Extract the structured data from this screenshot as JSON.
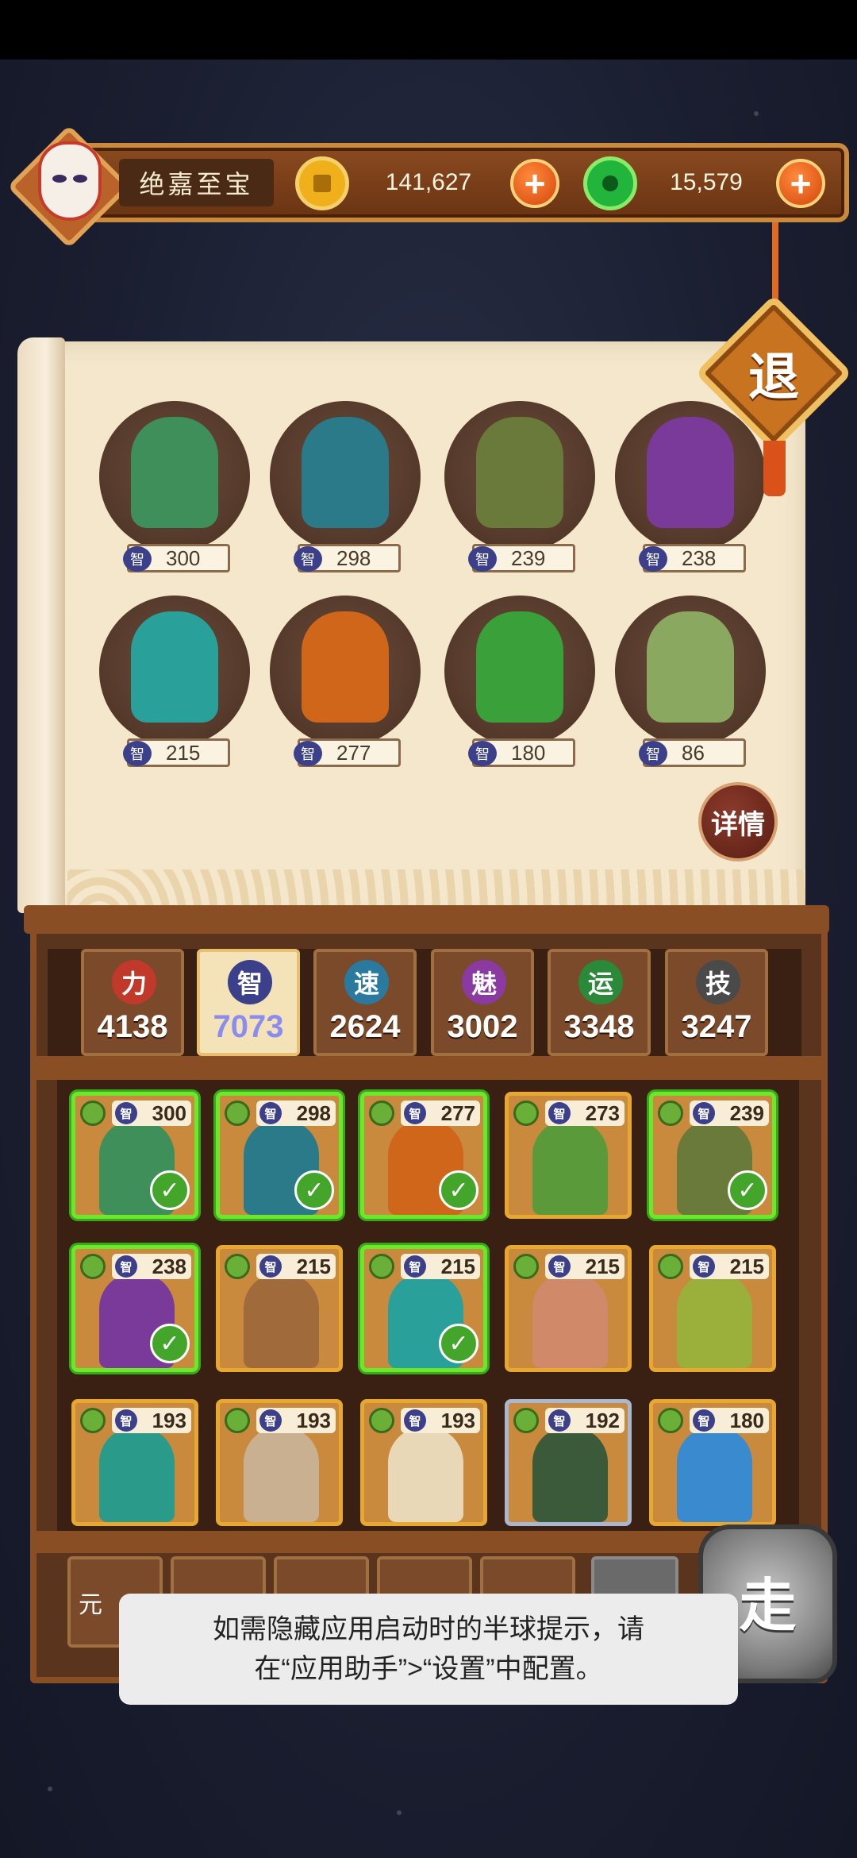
{
  "player": {
    "name": "绝嘉至宝",
    "gold": "141,627",
    "jade": "15,579",
    "plus": "+"
  },
  "buttons": {
    "retreat": "退",
    "details": "详情",
    "go": "走"
  },
  "selected_heroes": [
    {
      "stat": "智",
      "value": "300",
      "color": "#3f8f5a"
    },
    {
      "stat": "智",
      "value": "298",
      "color": "#2a7a8a"
    },
    {
      "stat": "智",
      "value": "239",
      "color": "#6a7a3a"
    },
    {
      "stat": "智",
      "value": "238",
      "color": "#7a3a9a"
    },
    {
      "stat": "智",
      "value": "215",
      "color": "#2aa09a"
    },
    {
      "stat": "智",
      "value": "277",
      "color": "#d0661a"
    },
    {
      "stat": "智",
      "value": "180",
      "color": "#3aa03a"
    },
    {
      "stat": "智",
      "value": "86",
      "color": "#8aa860"
    }
  ],
  "stats": [
    {
      "icon": "力",
      "value": "4138",
      "color": "#c0392b"
    },
    {
      "icon": "智",
      "value": "7073",
      "color": "#3c3f8a"
    },
    {
      "icon": "速",
      "value": "2624",
      "color": "#2a7aa0"
    },
    {
      "icon": "魅",
      "value": "3002",
      "color": "#8a3aa0"
    },
    {
      "icon": "运",
      "value": "3348",
      "color": "#2a8a3a"
    },
    {
      "icon": "技",
      "value": "3247",
      "color": "#4a4a4a"
    }
  ],
  "roster": [
    {
      "value": "300",
      "selected": true,
      "color": "#3f8f5a"
    },
    {
      "value": "298",
      "selected": true,
      "color": "#2a7a8a"
    },
    {
      "value": "277",
      "selected": true,
      "color": "#d0661a"
    },
    {
      "value": "273",
      "selected": false,
      "color": "#5a9a3a"
    },
    {
      "value": "239",
      "selected": true,
      "color": "#6a7a3a"
    },
    {
      "value": "238",
      "selected": true,
      "color": "#7a3a9a"
    },
    {
      "value": "215",
      "selected": false,
      "color": "#a06a3a"
    },
    {
      "value": "215",
      "selected": true,
      "color": "#2aa09a"
    },
    {
      "value": "215",
      "selected": false,
      "color": "#d08a6a"
    },
    {
      "value": "215",
      "selected": false,
      "color": "#9ab03a"
    },
    {
      "value": "193",
      "selected": false,
      "color": "#2a9a8a"
    },
    {
      "value": "193",
      "selected": false,
      "color": "#c8b090"
    },
    {
      "value": "193",
      "selected": false,
      "color": "#e8d8b8"
    },
    {
      "value": "192",
      "selected": false,
      "color": "#3a5a3a"
    },
    {
      "value": "180",
      "selected": false,
      "color": "#3a8ad0"
    }
  ],
  "roster_stat_label": "智",
  "check_mark": "✓",
  "bottom_tabs": [
    "元"
  ],
  "toast": {
    "line1": "如需隐藏应用启动时的半球提示，请",
    "line2": "在“应用助手”>“设置”中配置。"
  }
}
